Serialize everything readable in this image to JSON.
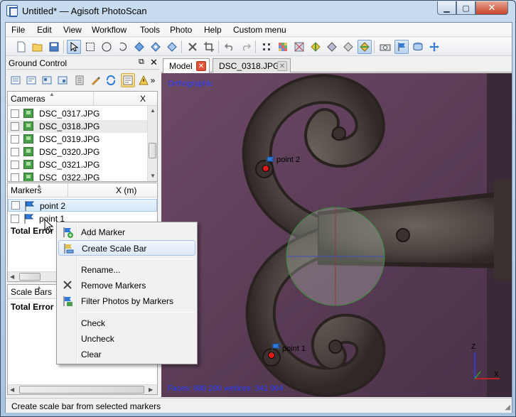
{
  "window": {
    "title": "Untitled* — Agisoft PhotoScan",
    "controls": {
      "minimize": "▁",
      "maximize": "▢",
      "close": "✕"
    }
  },
  "menubar": [
    "File",
    "Edit",
    "View",
    "Workflow",
    "Tools",
    "Photo",
    "Help",
    "Custom menu"
  ],
  "toolbar": {
    "icons": [
      "new-document-icon",
      "open-folder-icon",
      "save-icon",
      "select-arrow-icon",
      "rectangle-select-icon",
      "circle-select-icon",
      "free-select-icon",
      "rotate-object-icon",
      "move-object-icon",
      "scale-object-icon",
      "delete-icon",
      "crop-icon",
      "undo-icon",
      "redo-icon",
      "point-cloud-icon",
      "dense-cloud-icon",
      "wireframe-icon",
      "solid-shaded-icon",
      "solid-icon",
      "textured-icon",
      "camera-icon",
      "markers-view-icon",
      "region-icon",
      "navigation-icon"
    ]
  },
  "ground_control": {
    "title": "Ground Control",
    "float_icon": "⧉",
    "close_icon": "✕",
    "more_icon": "»"
  },
  "cameras": {
    "column": "Cameras",
    "column_x": "X",
    "rows": [
      "DSC_0317.JPG",
      "DSC_0318.JPG",
      "DSC_0319.JPG",
      "DSC_0320.JPG",
      "DSC_0321.JPG",
      "DSC_0322.JPG"
    ]
  },
  "markers": {
    "column": "Markers",
    "column_x": "X (m)",
    "rows": [
      "point 2",
      "point 1"
    ],
    "total_error": "Total Error"
  },
  "scale_bars": {
    "column": "Scale Bars",
    "total_error": "Total Error"
  },
  "tabs": [
    {
      "label": "Model",
      "close": "✕"
    },
    {
      "label": "DSC_0318.JPG",
      "close": "✕"
    }
  ],
  "viewport": {
    "projection": "Orthographic",
    "stats": "Faces: 680 200 vertices: 341 904",
    "point_labels": [
      "point 2",
      "point 1"
    ],
    "axis_labels": {
      "z": "Z",
      "x": "X"
    }
  },
  "context_menu": {
    "items": [
      {
        "label": "Add Marker",
        "icon": "add-marker-icon"
      },
      {
        "label": "Create Scale Bar",
        "icon": "scale-bar-icon"
      },
      {
        "label": "Rename..."
      },
      {
        "label": "Remove Markers",
        "icon": "remove-icon"
      },
      {
        "label": "Filter Photos by Markers",
        "icon": "filter-photos-icon"
      },
      {
        "label": "Check"
      },
      {
        "label": "Uncheck"
      },
      {
        "label": "Clear"
      }
    ]
  },
  "status": {
    "text": "Create scale bar from selected markers"
  }
}
